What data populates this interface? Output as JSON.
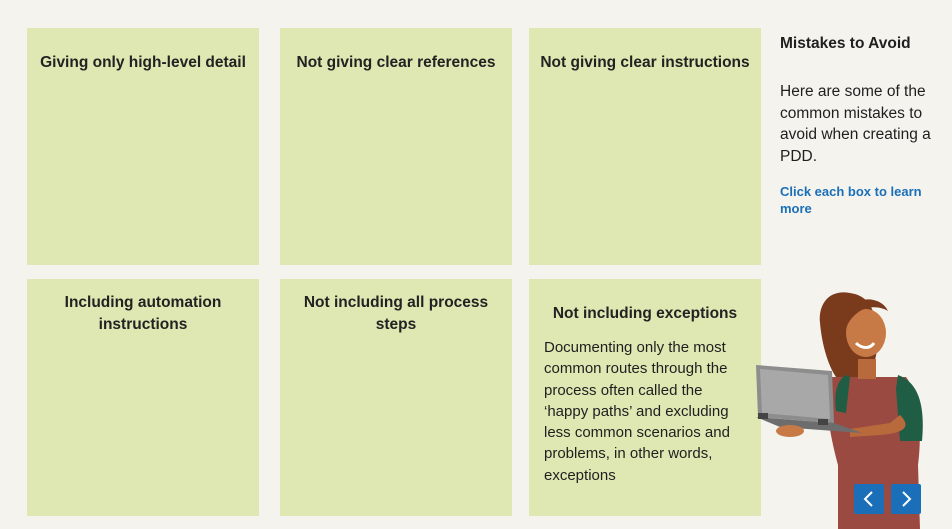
{
  "cards": [
    {
      "title": "Giving only high-level detail"
    },
    {
      "title": "Not giving clear references"
    },
    {
      "title": "Not giving clear instructions"
    },
    {
      "title": "Including automation instructions"
    },
    {
      "title": "Not including all process steps"
    },
    {
      "title": "Not including exceptions",
      "body": "Documenting only the most common routes through the process often called the ‘happy paths’ and excluding less common scenarios and problems, in other words, exceptions"
    }
  ],
  "sidebar": {
    "title": "Mistakes to Avoid",
    "intro": "Here are some of the common mistakes to avoid when creating a PDD.",
    "cta": "Click each box to learn more"
  },
  "nav": {
    "prev_icon": "chevron-left-icon",
    "next_icon": "chevron-right-icon"
  },
  "colors": {
    "card": "#dfe8b3",
    "accent": "#1a6fb8",
    "background": "#f4f3ee"
  }
}
